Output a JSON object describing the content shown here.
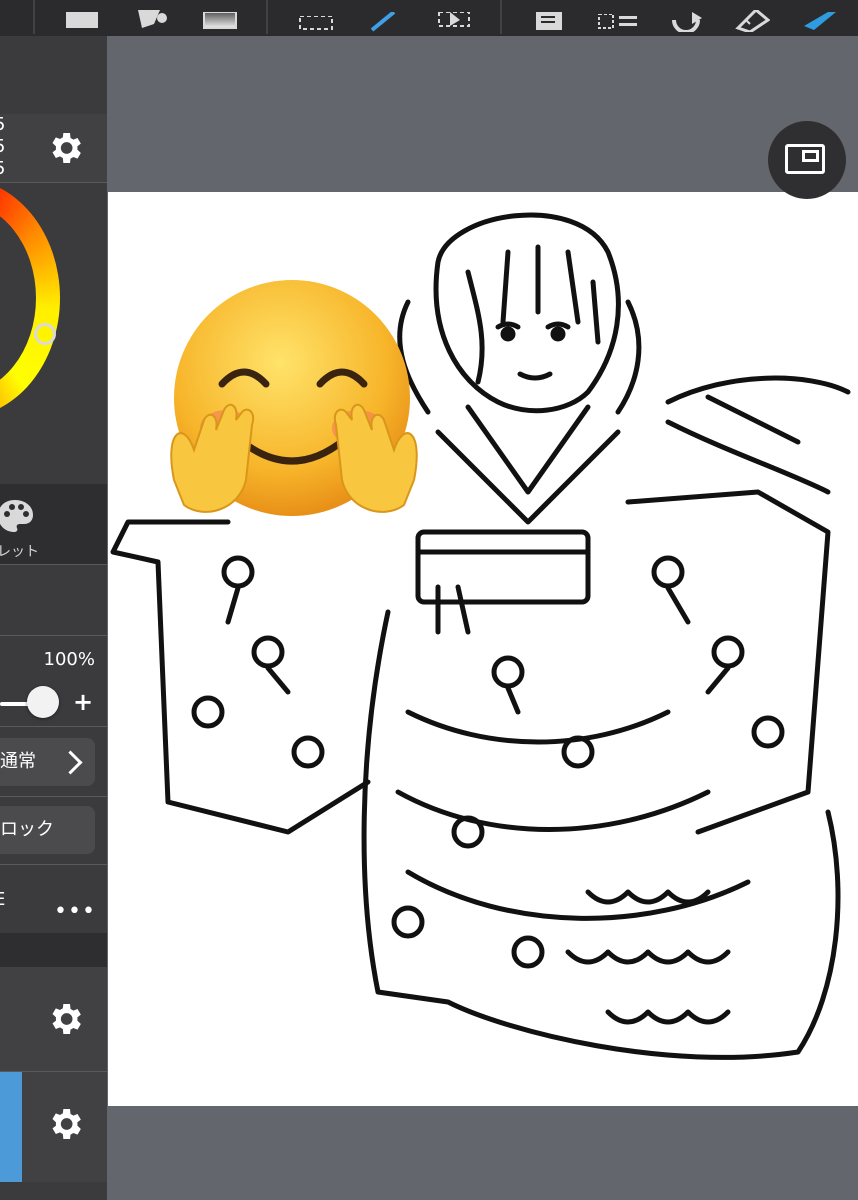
{
  "toolbar": {
    "icons": [
      "fill-color-icon",
      "bucket-icon",
      "gradient-icon",
      "rect-select-icon",
      "magic-wand-icon",
      "transform-icon",
      "copy-icon",
      "select-layer-icon",
      "undo-rotate-icon",
      "ruler-icon",
      "brush-icon"
    ]
  },
  "color_panel": {
    "rgb": [
      "5",
      "5",
      "5"
    ]
  },
  "tabs": {
    "palette_label": "レット"
  },
  "layer_panel": {
    "opacity": "100%",
    "blend_mode": "通常",
    "lock_label": "ロック",
    "layer_label_fragment": "E",
    "more": "•••"
  },
  "colors": {
    "toolbar_bg": "#2b2b2d",
    "panel_bg": "#3b3b3d",
    "workspace_bg": "#63676d",
    "canvas_bg": "#ffffff",
    "accent_blue": "#4d9ad8"
  }
}
